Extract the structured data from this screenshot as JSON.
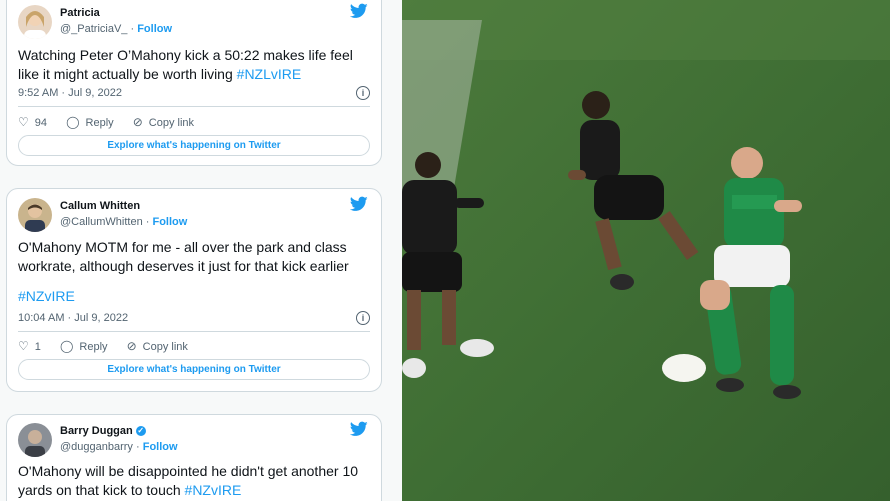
{
  "tweets": [
    {
      "name": "Patricia",
      "handle": "@_PatriciaV_",
      "follow": "Follow",
      "text": "Watching Peter O’Mahony kick a 50:22 makes life feel like it might actually be worth living",
      "hashtag": "#NZLvIRE",
      "time": "9:52 AM · Jul 9, 2022",
      "likes": "94",
      "reply": "Reply",
      "copy": "Copy link",
      "explore": "Explore what's happening on Twitter"
    },
    {
      "name": "Callum Whitten",
      "handle": "@CallumWhitten",
      "follow": "Follow",
      "text": "O'Mahony MOTM for me - all over the park and class workrate, although deserves it just for that kick earlier",
      "hashtag": "#NZvIRE",
      "time": "10:04 AM · Jul 9, 2022",
      "likes": "1",
      "reply": "Reply",
      "copy": "Copy link",
      "explore": "Explore what's happening on Twitter"
    },
    {
      "name": "Barry Duggan",
      "handle": "@dugganbarry",
      "follow": "Follow",
      "text": "O'Mahony will be disappointed he didn't get another 10 yards on that kick to touch",
      "hashtag": "#NZvIRE"
    }
  ],
  "colors": {
    "twitter_blue": "#1d9bf0",
    "pitch_green": "#3d6b34",
    "ireland_green": "#1f8a47",
    "all_blacks": "#1a1a1a"
  },
  "icons": [
    "twitter-bird-icon",
    "info-icon",
    "heart-icon",
    "reply-icon",
    "link-icon",
    "verified-icon"
  ]
}
